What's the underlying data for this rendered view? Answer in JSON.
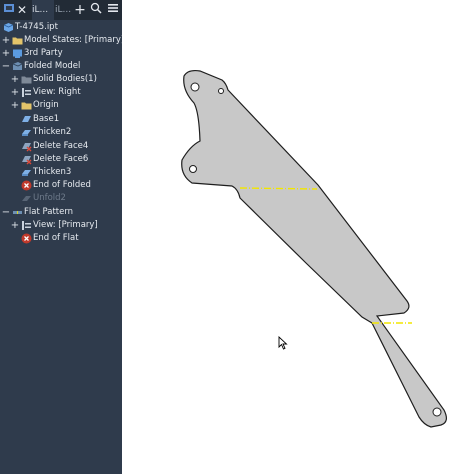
{
  "tabs": [
    {
      "label": "iL..."
    },
    {
      "label": "iL..."
    }
  ],
  "toolbar_icons": [
    "add-icon",
    "search-icon",
    "menu-icon"
  ],
  "tree": {
    "root": {
      "label": "T-4745.ipt"
    },
    "model_states": {
      "label": "Model States: [Primary]"
    },
    "third_party": {
      "label": "3rd Party"
    },
    "folded_model": {
      "label": "Folded Model"
    },
    "solid_bodies": {
      "label": "Solid Bodies(1)"
    },
    "view_right": {
      "label": "View: Right"
    },
    "origin": {
      "label": "Origin"
    },
    "base1": {
      "label": "Base1"
    },
    "thicken2": {
      "label": "Thicken2"
    },
    "delete_face4": {
      "label": "Delete Face4"
    },
    "delete_face6": {
      "label": "Delete Face6"
    },
    "thicken3": {
      "label": "Thicken3"
    },
    "end_of_folded": {
      "label": "End of Folded"
    },
    "unfold2": {
      "label": "Unfold2"
    },
    "flat_pattern": {
      "label": "Flat Pattern"
    },
    "view_primary": {
      "label": "View: [Primary]"
    },
    "end_of_flat": {
      "label": "End of Flat"
    }
  },
  "colors": {
    "panel_bg": "#2f3b4c",
    "part_fill": "#c8c8c8",
    "part_edge": "#1e1e1e",
    "bend_line": "#f2e600",
    "end_marker": "#c0392b"
  }
}
